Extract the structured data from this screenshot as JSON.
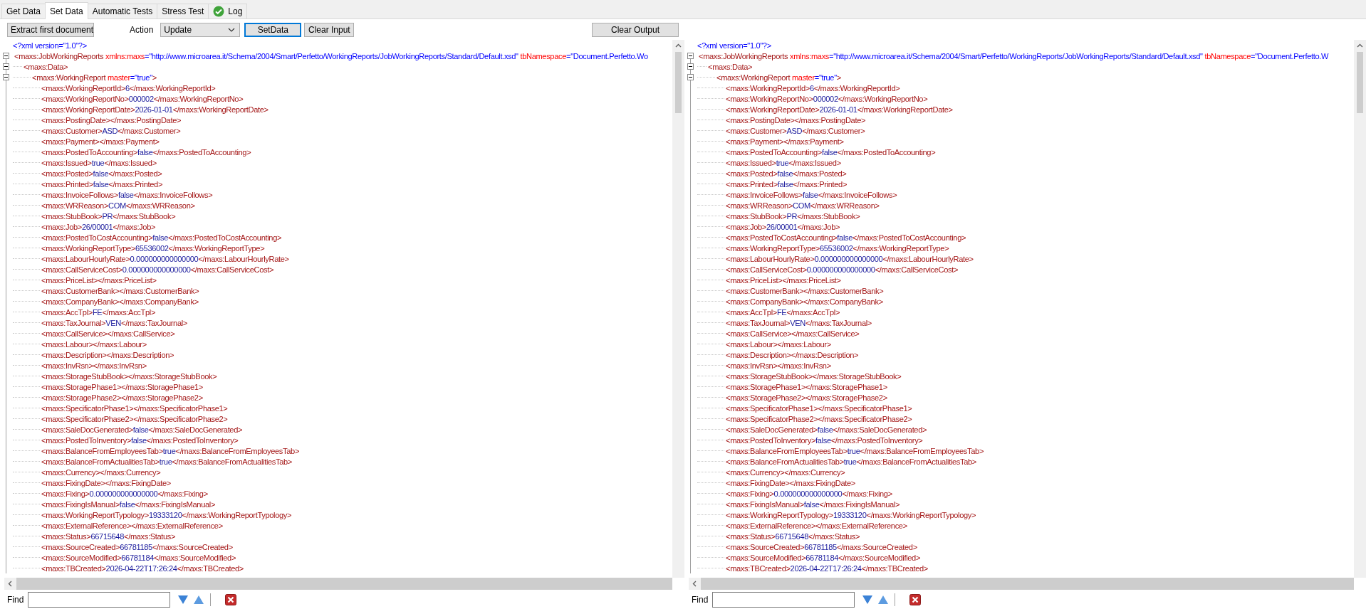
{
  "tabs": [
    {
      "label": "Get Data",
      "selected": false,
      "kind": "plain"
    },
    {
      "label": "Set Data",
      "selected": true,
      "kind": "plain"
    },
    {
      "label": "Automatic Tests",
      "selected": false,
      "kind": "plain"
    },
    {
      "label": "Stress Test",
      "selected": false,
      "kind": "plain"
    },
    {
      "label": "Log",
      "selected": false,
      "kind": "status"
    }
  ],
  "toolbar": {
    "extract_button": "Extract first document",
    "action_label": "Action",
    "action_value": "Update",
    "buttons": [
      {
        "label": "SetData",
        "focused": true
      },
      {
        "label": "Clear Input",
        "focused": false
      }
    ],
    "clear_output_button": "Clear Output"
  },
  "panes": [
    {
      "declaration": "<?xml version=\"1.0\"?>",
      "nodes": [
        {
          "open": "<maxs:JobWorkingReports",
          "attributes": [
            {
              "name": "xmlns:maxs",
              "value": "=\"http://www.microarea.it/Schema/2004/Smart/Perfetto/WorkingReports/JobWorkingReports/Standard/Default.xsd\""
            },
            {
              "name": "tbNamespace",
              "value": "=\"Document.Perfetto.Wo"
            }
          ],
          "expanded": true,
          "children": [
            {
              "open": "<maxs:Data>",
              "expanded": true,
              "children": [
                {
                  "open": "<maxs:WorkingReport",
                  "attributes": [
                    {
                      "name": "master",
                      "value": "=\"true\""
                    }
                  ],
                  "end": ">",
                  "expanded": true,
                  "children": [
                    {
                      "open": "<maxs:WorkingReportId>",
                      "value": "6",
                      "close": "</maxs:WorkingReportId>"
                    },
                    {
                      "open": "<maxs:WorkingReportNo>",
                      "value": "000002",
                      "close": "</maxs:WorkingReportNo>"
                    },
                    {
                      "open": "<maxs:WorkingReportDate>",
                      "value": "2026-01-01",
                      "close": "</maxs:WorkingReportDate>"
                    },
                    {
                      "open": "<maxs:PostingDate>",
                      "close": "</maxs:PostingDate>"
                    },
                    {
                      "open": "<maxs:Customer>",
                      "value": "ASD",
                      "close": "</maxs:Customer>"
                    },
                    {
                      "open": "<maxs:Payment>",
                      "close": "</maxs:Payment>"
                    },
                    {
                      "open": "<maxs:PostedToAccounting>",
                      "value": "false",
                      "close": "</maxs:PostedToAccounting>"
                    },
                    {
                      "open": "<maxs:Issued>",
                      "value": "true",
                      "close": "</maxs:Issued>"
                    },
                    {
                      "open": "<maxs:Posted>",
                      "value": "false",
                      "close": "</maxs:Posted>"
                    },
                    {
                      "open": "<maxs:Printed>",
                      "value": "false",
                      "close": "</maxs:Printed>"
                    },
                    {
                      "open": "<maxs:InvoiceFollows>",
                      "value": "false",
                      "close": "</maxs:InvoiceFollows>"
                    },
                    {
                      "open": "<maxs:WRReason>",
                      "value": "COM",
                      "close": "</maxs:WRReason>"
                    },
                    {
                      "open": "<maxs:StubBook>",
                      "value": "PR",
                      "close": "</maxs:StubBook>"
                    },
                    {
                      "open": "<maxs:Job>",
                      "value": "26/00001",
                      "close": "</maxs:Job>"
                    },
                    {
                      "open": "<maxs:PostedToCostAccounting>",
                      "value": "false",
                      "close": "</maxs:PostedToCostAccounting>"
                    },
                    {
                      "open": "<maxs:WorkingReportType>",
                      "value": "65536002",
                      "close": "</maxs:WorkingReportType>"
                    },
                    {
                      "open": "<maxs:LabourHourlyRate>",
                      "value": "0.000000000000000",
                      "close": "</maxs:LabourHourlyRate>"
                    },
                    {
                      "open": "<maxs:CallServiceCost>",
                      "value": "0.000000000000000",
                      "close": "</maxs:CallServiceCost>"
                    },
                    {
                      "open": "<maxs:PriceList>",
                      "close": "</maxs:PriceList>"
                    },
                    {
                      "open": "<maxs:CustomerBank>",
                      "close": "</maxs:CustomerBank>"
                    },
                    {
                      "open": "<maxs:CompanyBank>",
                      "close": "</maxs:CompanyBank>"
                    },
                    {
                      "open": "<maxs:AccTpl>",
                      "value": "FE",
                      "close": "</maxs:AccTpl>"
                    },
                    {
                      "open": "<maxs:TaxJournal>",
                      "value": "VEN",
                      "close": "</maxs:TaxJournal>"
                    },
                    {
                      "open": "<maxs:CallService>",
                      "close": "</maxs:CallService>"
                    },
                    {
                      "open": "<maxs:Labour>",
                      "close": "</maxs:Labour>"
                    },
                    {
                      "open": "<maxs:Description>",
                      "close": "</maxs:Description>"
                    },
                    {
                      "open": "<maxs:InvRsn>",
                      "close": "</maxs:InvRsn>"
                    },
                    {
                      "open": "<maxs:StorageStubBook>",
                      "close": "</maxs:StorageStubBook>"
                    },
                    {
                      "open": "<maxs:StoragePhase1>",
                      "close": "</maxs:StoragePhase1>"
                    },
                    {
                      "open": "<maxs:StoragePhase2>",
                      "close": "</maxs:StoragePhase2>"
                    },
                    {
                      "open": "<maxs:SpecificatorPhase1>",
                      "close": "</maxs:SpecificatorPhase1>"
                    },
                    {
                      "open": "<maxs:SpecificatorPhase2>",
                      "close": "</maxs:SpecificatorPhase2>"
                    },
                    {
                      "open": "<maxs:SaleDocGenerated>",
                      "value": "false",
                      "close": "</maxs:SaleDocGenerated>"
                    },
                    {
                      "open": "<maxs:PostedToInventory>",
                      "value": "false",
                      "close": "</maxs:PostedToInventory>"
                    },
                    {
                      "open": "<maxs:BalanceFromEmployeesTab>",
                      "value": "true",
                      "close": "</maxs:BalanceFromEmployeesTab>"
                    },
                    {
                      "open": "<maxs:BalanceFromActualitiesTab>",
                      "value": "true",
                      "close": "</maxs:BalanceFromActualitiesTab>"
                    },
                    {
                      "open": "<maxs:Currency>",
                      "close": "</maxs:Currency>"
                    },
                    {
                      "open": "<maxs:FixingDate>",
                      "close": "</maxs:FixingDate>"
                    },
                    {
                      "open": "<maxs:Fixing>",
                      "value": "0.000000000000000",
                      "close": "</maxs:Fixing>"
                    },
                    {
                      "open": "<maxs:FixingIsManual>",
                      "value": "false",
                      "close": "</maxs:FixingIsManual>"
                    },
                    {
                      "open": "<maxs:WorkingReportTypology>",
                      "value": "19333120",
                      "close": "</maxs:WorkingReportTypology>"
                    },
                    {
                      "open": "<maxs:ExternalReference>",
                      "close": "</maxs:ExternalReference>"
                    },
                    {
                      "open": "<maxs:Status>",
                      "value": "66715648",
                      "close": "</maxs:Status>"
                    },
                    {
                      "open": "<maxs:SourceCreated>",
                      "value": "66781185",
                      "close": "</maxs:SourceCreated>"
                    },
                    {
                      "open": "<maxs:SourceModified>",
                      "value": "66781184",
                      "close": "</maxs:SourceModified>"
                    },
                    {
                      "open": "<maxs:TBCreated>",
                      "value": "2026-04-22T17:26:24",
                      "close": "</maxs:TBCreated>"
                    }
                  ]
                }
              ]
            }
          ]
        }
      ],
      "find_label": "Find"
    },
    {
      "declaration": "<?xml version=\"1.0\"?>",
      "nodes": [
        {
          "open": "<maxs:JobWorkingReports",
          "attributes": [
            {
              "name": "xmlns:maxs",
              "value": "=\"http://www.microarea.it/Schema/2004/Smart/Perfetto/WorkingReports/JobWorkingReports/Standard/Default.xsd\""
            },
            {
              "name": "tbNamespace",
              "value": "=\"Document.Perfetto.W"
            }
          ],
          "expanded": true,
          "children": [
            {
              "open": "<maxs:Data>",
              "expanded": true,
              "children": [
                {
                  "open": "<maxs:WorkingReport",
                  "attributes": [
                    {
                      "name": "master",
                      "value": "=\"true\""
                    }
                  ],
                  "end": ">",
                  "expanded": true,
                  "children": [
                    {
                      "open": "<maxs:WorkingReportId>",
                      "value": "6",
                      "close": "</maxs:WorkingReportId>"
                    },
                    {
                      "open": "<maxs:WorkingReportNo>",
                      "value": "000002",
                      "close": "</maxs:WorkingReportNo>"
                    },
                    {
                      "open": "<maxs:WorkingReportDate>",
                      "value": "2026-01-01",
                      "close": "</maxs:WorkingReportDate>"
                    },
                    {
                      "open": "<maxs:PostingDate>",
                      "close": "</maxs:PostingDate>"
                    },
                    {
                      "open": "<maxs:Customer>",
                      "value": "ASD",
                      "close": "</maxs:Customer>"
                    },
                    {
                      "open": "<maxs:Payment>",
                      "close": "</maxs:Payment>"
                    },
                    {
                      "open": "<maxs:PostedToAccounting>",
                      "value": "false",
                      "close": "</maxs:PostedToAccounting>"
                    },
                    {
                      "open": "<maxs:Issued>",
                      "value": "true",
                      "close": "</maxs:Issued>"
                    },
                    {
                      "open": "<maxs:Posted>",
                      "value": "false",
                      "close": "</maxs:Posted>"
                    },
                    {
                      "open": "<maxs:Printed>",
                      "value": "false",
                      "close": "</maxs:Printed>"
                    },
                    {
                      "open": "<maxs:InvoiceFollows>",
                      "value": "false",
                      "close": "</maxs:InvoiceFollows>"
                    },
                    {
                      "open": "<maxs:WRReason>",
                      "value": "COM",
                      "close": "</maxs:WRReason>"
                    },
                    {
                      "open": "<maxs:StubBook>",
                      "value": "PR",
                      "close": "</maxs:StubBook>"
                    },
                    {
                      "open": "<maxs:Job>",
                      "value": "26/00001",
                      "close": "</maxs:Job>"
                    },
                    {
                      "open": "<maxs:PostedToCostAccounting>",
                      "value": "false",
                      "close": "</maxs:PostedToCostAccounting>"
                    },
                    {
                      "open": "<maxs:WorkingReportType>",
                      "value": "65536002",
                      "close": "</maxs:WorkingReportType>"
                    },
                    {
                      "open": "<maxs:LabourHourlyRate>",
                      "value": "0.000000000000000",
                      "close": "</maxs:LabourHourlyRate>"
                    },
                    {
                      "open": "<maxs:CallServiceCost>",
                      "value": "0.000000000000000",
                      "close": "</maxs:CallServiceCost>"
                    },
                    {
                      "open": "<maxs:PriceList>",
                      "close": "</maxs:PriceList>"
                    },
                    {
                      "open": "<maxs:CustomerBank>",
                      "close": "</maxs:CustomerBank>"
                    },
                    {
                      "open": "<maxs:CompanyBank>",
                      "close": "</maxs:CompanyBank>"
                    },
                    {
                      "open": "<maxs:AccTpl>",
                      "value": "FE",
                      "close": "</maxs:AccTpl>"
                    },
                    {
                      "open": "<maxs:TaxJournal>",
                      "value": "VEN",
                      "close": "</maxs:TaxJournal>"
                    },
                    {
                      "open": "<maxs:CallService>",
                      "close": "</maxs:CallService>"
                    },
                    {
                      "open": "<maxs:Labour>",
                      "close": "</maxs:Labour>"
                    },
                    {
                      "open": "<maxs:Description>",
                      "close": "</maxs:Description>"
                    },
                    {
                      "open": "<maxs:InvRsn>",
                      "close": "</maxs:InvRsn>"
                    },
                    {
                      "open": "<maxs:StorageStubBook>",
                      "close": "</maxs:StorageStubBook>"
                    },
                    {
                      "open": "<maxs:StoragePhase1>",
                      "close": "</maxs:StoragePhase1>"
                    },
                    {
                      "open": "<maxs:StoragePhase2>",
                      "close": "</maxs:StoragePhase2>"
                    },
                    {
                      "open": "<maxs:SpecificatorPhase1>",
                      "close": "</maxs:SpecificatorPhase1>"
                    },
                    {
                      "open": "<maxs:SpecificatorPhase2>",
                      "close": "</maxs:SpecificatorPhase2>"
                    },
                    {
                      "open": "<maxs:SaleDocGenerated>",
                      "value": "false",
                      "close": "</maxs:SaleDocGenerated>"
                    },
                    {
                      "open": "<maxs:PostedToInventory>",
                      "value": "false",
                      "close": "</maxs:PostedToInventory>"
                    },
                    {
                      "open": "<maxs:BalanceFromEmployeesTab>",
                      "value": "true",
                      "close": "</maxs:BalanceFromEmployeesTab>"
                    },
                    {
                      "open": "<maxs:BalanceFromActualitiesTab>",
                      "value": "true",
                      "close": "</maxs:BalanceFromActualitiesTab>"
                    },
                    {
                      "open": "<maxs:Currency>",
                      "close": "</maxs:Currency>"
                    },
                    {
                      "open": "<maxs:FixingDate>",
                      "close": "</maxs:FixingDate>"
                    },
                    {
                      "open": "<maxs:Fixing>",
                      "value": "0.000000000000000",
                      "close": "</maxs:Fixing>"
                    },
                    {
                      "open": "<maxs:FixingIsManual>",
                      "value": "false",
                      "close": "</maxs:FixingIsManual>"
                    },
                    {
                      "open": "<maxs:WorkingReportTypology>",
                      "value": "19333120",
                      "close": "</maxs:WorkingReportTypology>"
                    },
                    {
                      "open": "<maxs:ExternalReference>",
                      "close": "</maxs:ExternalReference>"
                    },
                    {
                      "open": "<maxs:Status>",
                      "value": "66715648",
                      "close": "</maxs:Status>"
                    },
                    {
                      "open": "<maxs:SourceCreated>",
                      "value": "66781185",
                      "close": "</maxs:SourceCreated>"
                    },
                    {
                      "open": "<maxs:SourceModified>",
                      "value": "66781184",
                      "close": "</maxs:SourceModified>"
                    },
                    {
                      "open": "<maxs:TBCreated>",
                      "value": "2026-04-22T17:26:24",
                      "close": "</maxs:TBCreated>"
                    }
                  ]
                }
              ]
            }
          ]
        }
      ],
      "find_label": "Find"
    }
  ]
}
